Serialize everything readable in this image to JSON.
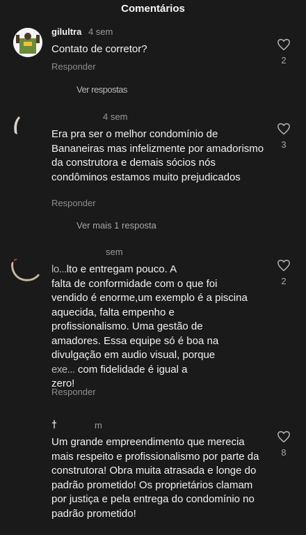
{
  "header": {
    "title": "Comentários"
  },
  "comments": [
    {
      "username": "gilultra",
      "time": "4 sem",
      "text": "Contato de corretor?",
      "reply_label": "Responder",
      "likes": "2"
    },
    {
      "username": "",
      "time": "4 sem",
      "text": "Era pra ser o melhor condomínio de Bananeiras mas infelizmente por amadorismo da construtora e demais sócios nós condôminos estamos muito prejudicados",
      "reply_label": "Responder",
      "likes": "3",
      "more_replies": "Ver mais 1 resposta"
    },
    {
      "username": "",
      "time": "sem",
      "text_prefix": "lo...",
      "text_lines": [
        "lto e entregam pouco. A",
        "falta de conformidade com o que foi",
        "vendido é enorme,um exemplo é a piscina",
        "aquecida, falta empenho e",
        "profissionalismo. Uma gestão de",
        "amadores. Essa equipe só é boa na",
        "divulgação em audio visual, porque",
        " com fidelidade é igual a",
        "zero!"
      ],
      "reply_label": "Responder",
      "likes": "2"
    },
    {
      "username": "",
      "time": "m",
      "text": "Um grande empreendimento que merecia mais respeito e profissionalismo por parte da construtora! Obra muita atrasada e longe do padrão prometido! Os proprietários clamam por justiça e pela entrega do condomínio no padrão prometido!",
      "likes": "8"
    }
  ],
  "between_label": "Ver respostas",
  "colors": {
    "background": "#1a1a1a",
    "text": "#f2f2f2",
    "muted": "#8e8e8e"
  }
}
